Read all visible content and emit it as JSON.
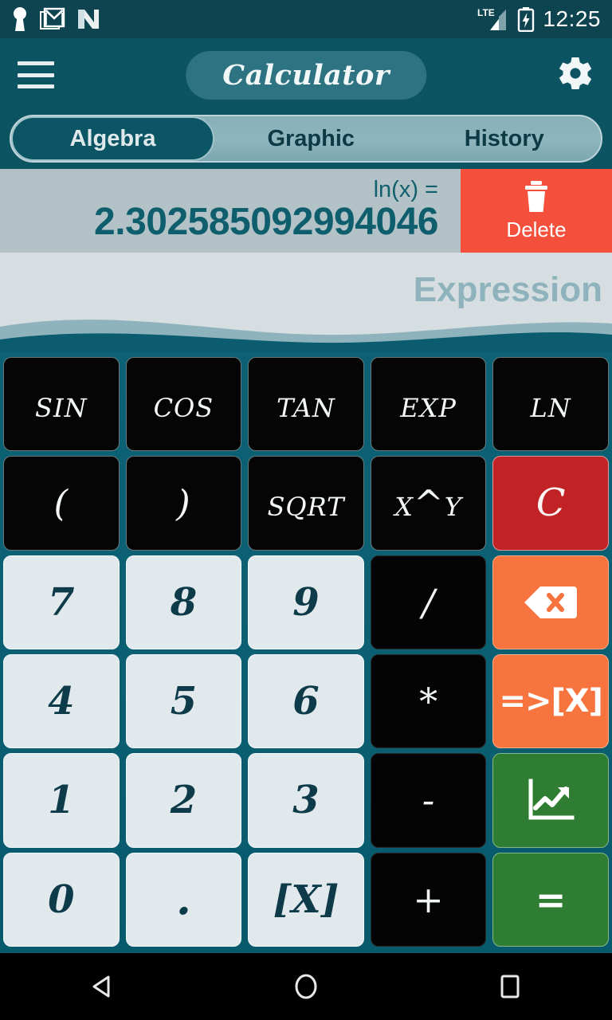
{
  "status_bar": {
    "time": "12:25",
    "network": "LTE",
    "icons": [
      "lock-keyhole-icon",
      "gmail-icon",
      "nova-n-icon",
      "lte-signal-icon",
      "battery-charging-icon"
    ]
  },
  "app_bar": {
    "menu_icon": "hamburger-menu-icon",
    "title": "Calculator",
    "settings_icon": "gear-icon"
  },
  "tabs": [
    {
      "label": "Algebra",
      "active": true
    },
    {
      "label": "Graphic",
      "active": false
    },
    {
      "label": "History",
      "active": false
    }
  ],
  "display": {
    "label": "ln(x) =",
    "value": "2.302585092994046",
    "delete_label": "Delete",
    "delete_icon": "trash-icon"
  },
  "expression": {
    "placeholder": "Expression",
    "value": ""
  },
  "keypad": {
    "rows": [
      [
        {
          "label": "sin",
          "name": "sin",
          "style": "fn"
        },
        {
          "label": "cos",
          "name": "cos",
          "style": "fn"
        },
        {
          "label": "tan",
          "name": "tan",
          "style": "fn"
        },
        {
          "label": "exp",
          "name": "exp",
          "style": "fn"
        },
        {
          "label": "ln",
          "name": "ln",
          "style": "fn"
        }
      ],
      [
        {
          "label": "(",
          "name": "open-paren",
          "style": "fn"
        },
        {
          "label": ")",
          "name": "close-paren",
          "style": "fn"
        },
        {
          "label": "sqrt",
          "name": "sqrt",
          "style": "fn"
        },
        {
          "label": "x^y",
          "name": "power",
          "style": "fn"
        },
        {
          "label": "C",
          "name": "clear",
          "style": "clear"
        }
      ],
      [
        {
          "label": "7",
          "name": "digit-7",
          "style": "num"
        },
        {
          "label": "8",
          "name": "digit-8",
          "style": "num"
        },
        {
          "label": "9",
          "name": "digit-9",
          "style": "num"
        },
        {
          "label": "/",
          "name": "divide",
          "style": "op"
        },
        {
          "label": "",
          "name": "backspace",
          "style": "orange",
          "icon": "backspace-icon"
        }
      ],
      [
        {
          "label": "4",
          "name": "digit-4",
          "style": "num"
        },
        {
          "label": "5",
          "name": "digit-5",
          "style": "num"
        },
        {
          "label": "6",
          "name": "digit-6",
          "style": "num"
        },
        {
          "label": "*",
          "name": "multiply",
          "style": "op"
        },
        {
          "label": "=>[X]",
          "name": "assign-variable",
          "style": "orange"
        }
      ],
      [
        {
          "label": "1",
          "name": "digit-1",
          "style": "num"
        },
        {
          "label": "2",
          "name": "digit-2",
          "style": "num"
        },
        {
          "label": "3",
          "name": "digit-3",
          "style": "num"
        },
        {
          "label": "-",
          "name": "subtract",
          "style": "op"
        },
        {
          "label": "",
          "name": "plot-graph",
          "style": "green",
          "icon": "chart-line-icon"
        }
      ],
      [
        {
          "label": "0",
          "name": "digit-0",
          "style": "num"
        },
        {
          "label": ".",
          "name": "decimal-point",
          "style": "num dot"
        },
        {
          "label": "[X]",
          "name": "variable-x",
          "style": "num"
        },
        {
          "label": "+",
          "name": "add",
          "style": "op"
        },
        {
          "label": "=",
          "name": "equals",
          "style": "green"
        }
      ]
    ]
  },
  "nav_bar": {
    "back": "back-triangle-icon",
    "home": "home-circle-icon",
    "recents": "recents-square-icon"
  },
  "colors": {
    "teal_dark": "#0d4450",
    "teal_appbar": "#0d5463",
    "teal_keypad": "#0b5f72",
    "display_bg": "#b2c2c6",
    "display_text": "#0e5e6e",
    "delete_red": "#f4503c",
    "clear_red": "#c12226",
    "orange": "#f8743f",
    "green": "#2f7d32",
    "num_key": "#e1e9ec",
    "expr_bg": "#d6dee1",
    "expr_placeholder": "#8fb3bd"
  }
}
